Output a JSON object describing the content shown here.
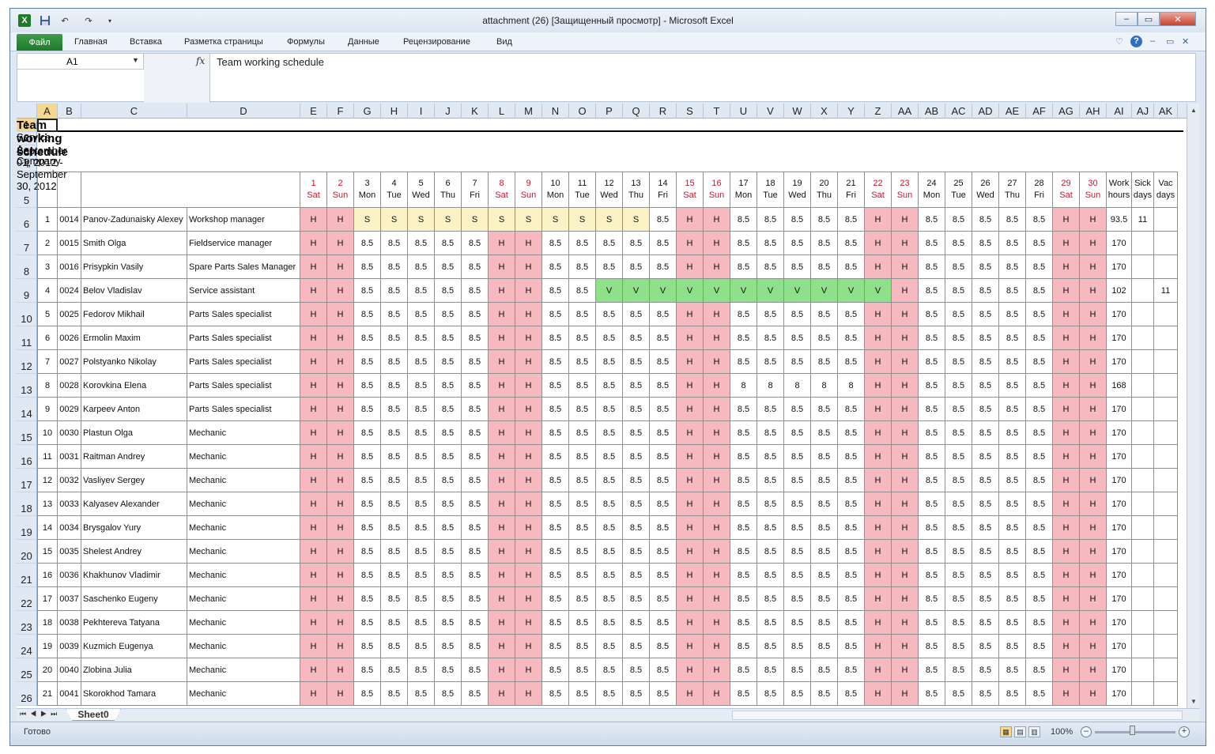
{
  "window": {
    "title": "attachment (26)  [Защищенный просмотр]  -  Microsoft Excel",
    "controls": [
      "–",
      "▭",
      "✕"
    ]
  },
  "qat": {
    "app_icon": "X",
    "save_icon": "save-icon",
    "undo": "↶",
    "redo": "↷"
  },
  "ribbon": {
    "file": "Файл",
    "tabs": [
      "Главная",
      "Вставка",
      "Разметка страницы",
      "Формулы",
      "Данные",
      "Рецензирование",
      "Вид"
    ],
    "help": "?"
  },
  "formula_bar": {
    "name_box": "A1",
    "fx": "fx",
    "content": "Team working schedule"
  },
  "columns": [
    "A",
    "B",
    "C",
    "D",
    "E",
    "F",
    "G",
    "H",
    "I",
    "J",
    "K",
    "L",
    "M",
    "N",
    "O",
    "P",
    "Q",
    "R",
    "S",
    "T",
    "U",
    "V",
    "W",
    "X",
    "Y",
    "Z",
    "AA",
    "AB",
    "AC",
    "AD",
    "AE",
    "AF",
    "AG",
    "AH",
    "AI",
    "AJ",
    "AK"
  ],
  "sheet": {
    "title": "Team working schedule",
    "subtitle": "Service, A-Company",
    "period": "September 01, 2012 - September 30, 2012",
    "days": [
      {
        "n": "1",
        "d": "Sat"
      },
      {
        "n": "2",
        "d": "Sun"
      },
      {
        "n": "3",
        "d": "Mon"
      },
      {
        "n": "4",
        "d": "Tue"
      },
      {
        "n": "5",
        "d": "Wed"
      },
      {
        "n": "6",
        "d": "Thu"
      },
      {
        "n": "7",
        "d": "Fri"
      },
      {
        "n": "8",
        "d": "Sat"
      },
      {
        "n": "9",
        "d": "Sun"
      },
      {
        "n": "10",
        "d": "Mon"
      },
      {
        "n": "11",
        "d": "Tue"
      },
      {
        "n": "12",
        "d": "Wed"
      },
      {
        "n": "13",
        "d": "Thu"
      },
      {
        "n": "14",
        "d": "Fri"
      },
      {
        "n": "15",
        "d": "Sat"
      },
      {
        "n": "16",
        "d": "Sun"
      },
      {
        "n": "17",
        "d": "Mon"
      },
      {
        "n": "18",
        "d": "Tue"
      },
      {
        "n": "19",
        "d": "Wed"
      },
      {
        "n": "20",
        "d": "Thu"
      },
      {
        "n": "21",
        "d": "Fri"
      },
      {
        "n": "22",
        "d": "Sat"
      },
      {
        "n": "23",
        "d": "Sun"
      },
      {
        "n": "24",
        "d": "Mon"
      },
      {
        "n": "25",
        "d": "Tue"
      },
      {
        "n": "26",
        "d": "Wed"
      },
      {
        "n": "27",
        "d": "Thu"
      },
      {
        "n": "28",
        "d": "Fri"
      },
      {
        "n": "29",
        "d": "Sat"
      },
      {
        "n": "30",
        "d": "Sun"
      }
    ],
    "summary_headers": [
      [
        "Work",
        "hours"
      ],
      [
        "Sick",
        "days"
      ],
      [
        "Vac",
        "days"
      ]
    ],
    "employees": [
      {
        "num": "1",
        "id": "0014",
        "name": "Panov-Zadunaisky Alexey",
        "role": "Workshop manager",
        "days": [
          "H",
          "H",
          "S",
          "S",
          "S",
          "S",
          "S",
          "S",
          "S",
          "S",
          "S",
          "S",
          "S",
          "8.5",
          "H",
          "H",
          "8.5",
          "8.5",
          "8.5",
          "8.5",
          "8.5",
          "H",
          "H",
          "8.5",
          "8.5",
          "8.5",
          "8.5",
          "8.5",
          "H",
          "H"
        ],
        "work": "93.5",
        "sick": "11",
        "vac": ""
      },
      {
        "num": "2",
        "id": "0015",
        "name": "Smith Olga",
        "role": "Fieldservice manager",
        "days": "std",
        "work": "170",
        "sick": "",
        "vac": ""
      },
      {
        "num": "3",
        "id": "0016",
        "name": "Prisypkin Vasily",
        "role": "Spare Parts Sales Manager",
        "days": "std",
        "work": "170",
        "sick": "",
        "vac": ""
      },
      {
        "num": "4",
        "id": "0024",
        "name": "Belov Vladislav",
        "role": "Service assistant",
        "days": [
          "H",
          "H",
          "8.5",
          "8.5",
          "8.5",
          "8.5",
          "8.5",
          "H",
          "H",
          "8.5",
          "8.5",
          "V",
          "V",
          "V",
          "V",
          "V",
          "V",
          "V",
          "V",
          "V",
          "V",
          "V",
          "H",
          "8.5",
          "8.5",
          "8.5",
          "8.5",
          "8.5",
          "H",
          "H"
        ],
        "work": "102",
        "sick": "",
        "vac": "11"
      },
      {
        "num": "5",
        "id": "0025",
        "name": "Fedorov Mikhail",
        "role": "Parts Sales specialist",
        "days": "std",
        "work": "170",
        "sick": "",
        "vac": ""
      },
      {
        "num": "6",
        "id": "0026",
        "name": "Ermolin Maxim",
        "role": "Parts Sales specialist",
        "days": "std",
        "work": "170",
        "sick": "",
        "vac": ""
      },
      {
        "num": "7",
        "id": "0027",
        "name": "Polstyanko Nikolay",
        "role": "Parts Sales specialist",
        "days": "std",
        "work": "170",
        "sick": "",
        "vac": ""
      },
      {
        "num": "8",
        "id": "0028",
        "name": "Korovkina Elena",
        "role": "Parts Sales specialist",
        "days": [
          "H",
          "H",
          "8.5",
          "8.5",
          "8.5",
          "8.5",
          "8.5",
          "H",
          "H",
          "8.5",
          "8.5",
          "8.5",
          "8.5",
          "8.5",
          "H",
          "H",
          "8",
          "8",
          "8",
          "8",
          "8",
          "H",
          "H",
          "8.5",
          "8.5",
          "8.5",
          "8.5",
          "8.5",
          "H",
          "H"
        ],
        "work": "168",
        "sick": "",
        "vac": ""
      },
      {
        "num": "9",
        "id": "0029",
        "name": "Karpeev Anton",
        "role": "Parts Sales specialist",
        "days": "std",
        "work": "170",
        "sick": "",
        "vac": ""
      },
      {
        "num": "10",
        "id": "0030",
        "name": "Plastun Olga",
        "role": "Mechanic",
        "days": "std",
        "work": "170",
        "sick": "",
        "vac": ""
      },
      {
        "num": "11",
        "id": "0031",
        "name": "Raitman Andrey",
        "role": "Mechanic",
        "days": "std",
        "work": "170",
        "sick": "",
        "vac": ""
      },
      {
        "num": "12",
        "id": "0032",
        "name": "Vasliyev Sergey",
        "role": "Mechanic",
        "days": "std",
        "work": "170",
        "sick": "",
        "vac": ""
      },
      {
        "num": "13",
        "id": "0033",
        "name": "Kalyasev Alexander",
        "role": "Mechanic",
        "days": "std",
        "work": "170",
        "sick": "",
        "vac": ""
      },
      {
        "num": "14",
        "id": "0034",
        "name": "Brysgalov Yury",
        "role": "Mechanic",
        "days": "std",
        "work": "170",
        "sick": "",
        "vac": ""
      },
      {
        "num": "15",
        "id": "0035",
        "name": "Shelest Andrey",
        "role": "Mechanic",
        "days": "std",
        "work": "170",
        "sick": "",
        "vac": ""
      },
      {
        "num": "16",
        "id": "0036",
        "name": "Khakhunov Vladimir",
        "role": "Mechanic",
        "days": "std",
        "work": "170",
        "sick": "",
        "vac": ""
      },
      {
        "num": "17",
        "id": "0037",
        "name": "Saschenko Eugeny",
        "role": "Mechanic",
        "days": "std",
        "work": "170",
        "sick": "",
        "vac": ""
      },
      {
        "num": "18",
        "id": "0038",
        "name": "Pekhtereva Tatyana",
        "role": "Mechanic",
        "days": "std",
        "work": "170",
        "sick": "",
        "vac": ""
      },
      {
        "num": "19",
        "id": "0039",
        "name": "Kuzmich Eugenya",
        "role": "Mechanic",
        "days": "std",
        "work": "170",
        "sick": "",
        "vac": ""
      },
      {
        "num": "20",
        "id": "0040",
        "name": "Zlobina Julia",
        "role": "Mechanic",
        "days": "std",
        "work": "170",
        "sick": "",
        "vac": ""
      },
      {
        "num": "21",
        "id": "0041",
        "name": "Skorokhod Tamara",
        "role": "Mechanic",
        "days": "std",
        "work": "170",
        "sick": "",
        "vac": ""
      }
    ],
    "std_days": [
      "H",
      "H",
      "8.5",
      "8.5",
      "8.5",
      "8.5",
      "8.5",
      "H",
      "H",
      "8.5",
      "8.5",
      "8.5",
      "8.5",
      "8.5",
      "H",
      "H",
      "8.5",
      "8.5",
      "8.5",
      "8.5",
      "8.5",
      "H",
      "H",
      "8.5",
      "8.5",
      "8.5",
      "8.5",
      "8.5",
      "H",
      "H"
    ]
  },
  "tabs": {
    "sheet": "Sheet0"
  },
  "status": {
    "ready": "Готово",
    "zoom": "100%"
  },
  "colors": {
    "holiday": "#f7b9c0",
    "sick": "#fbf3c6",
    "vacation": "#8fe08a",
    "weekend_text": "#d0142a",
    "file_tab": "#1e7b2a"
  }
}
